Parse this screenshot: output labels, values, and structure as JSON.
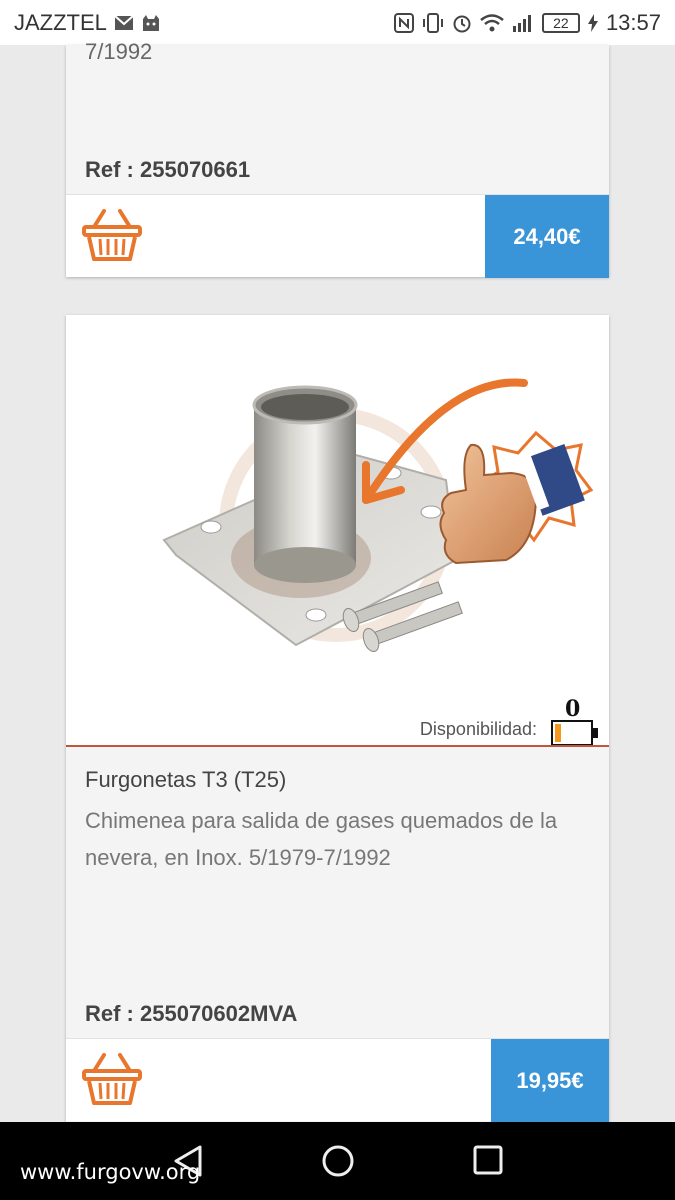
{
  "status_bar": {
    "carrier": "JAZZTEL",
    "battery": "22",
    "time": "13:57",
    "icons": [
      "mail-icon",
      "cat-icon",
      "nfc-icon",
      "vibrate-icon",
      "alarm-icon",
      "wifi-icon",
      "signal-icon",
      "battery-icon",
      "charging-icon"
    ]
  },
  "products": [
    {
      "desc_tail": "7/1992",
      "ref": "Ref : 255070661",
      "price": "24,40€"
    },
    {
      "availability_label": "Disponibilidad:",
      "stock": "0",
      "title": "Furgonetas T3 (T25)",
      "description": "Chimenea para salida de gases quemados de la nevera, en Inox. 5/1979-7/1992",
      "ref": "Ref : 255070602MVA",
      "price": "19,95€"
    }
  ],
  "nav_bar": {
    "buttons": [
      "back-button",
      "home-button",
      "recents-button"
    ]
  },
  "watermark": "www.furgovw.org",
  "colors": {
    "price_button": "#3a94d8",
    "basket": "#e8762c",
    "divider": "#c0563a"
  }
}
